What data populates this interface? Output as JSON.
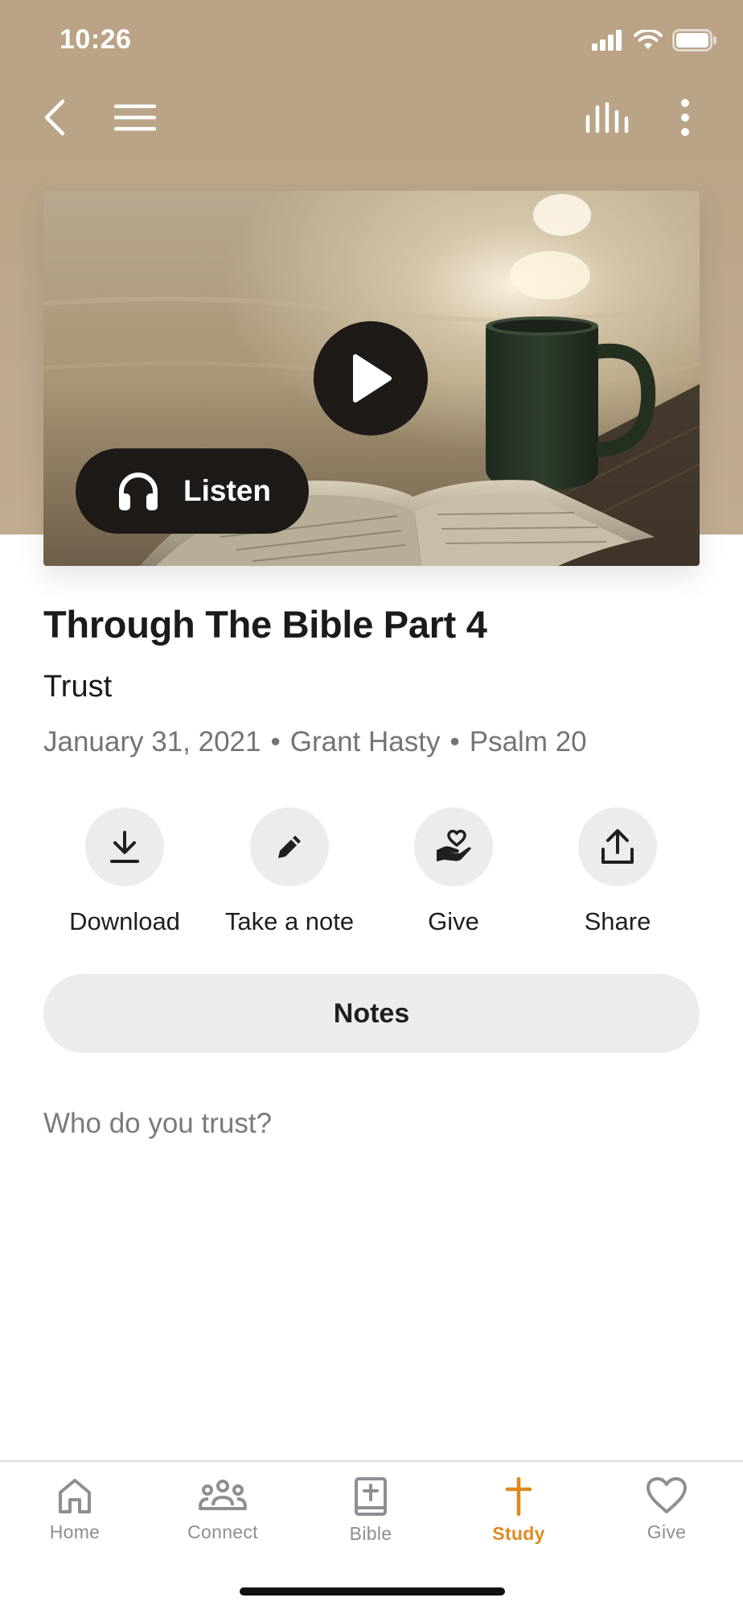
{
  "status_bar": {
    "time": "10:26"
  },
  "sermon": {
    "title": "Through The Bible Part 4",
    "subtitle": "Trust",
    "date": "January 31, 2021",
    "speaker": "Grant Hasty",
    "scripture": "Psalm 20",
    "description": "Who do you trust?"
  },
  "media": {
    "listen_label": "Listen"
  },
  "actions": [
    {
      "label": "Download",
      "icon": "download-icon"
    },
    {
      "label": "Take a note",
      "icon": "pencil-icon"
    },
    {
      "label": "Give",
      "icon": "give-hand-heart-icon"
    },
    {
      "label": "Share",
      "icon": "share-icon"
    }
  ],
  "notes_label": "Notes",
  "tabs": [
    {
      "label": "Home",
      "icon": "home-icon",
      "active": false
    },
    {
      "label": "Connect",
      "icon": "people-icon",
      "active": false
    },
    {
      "label": "Bible",
      "icon": "bible-icon",
      "active": false
    },
    {
      "label": "Study",
      "icon": "cross-icon",
      "active": true
    },
    {
      "label": "Give",
      "icon": "heart-icon",
      "active": false
    }
  ],
  "colors": {
    "accent": "#e08a1e",
    "header_bg": "#bca78c",
    "button_bg": "#ececee",
    "overlay_button": "#1e1a17"
  }
}
